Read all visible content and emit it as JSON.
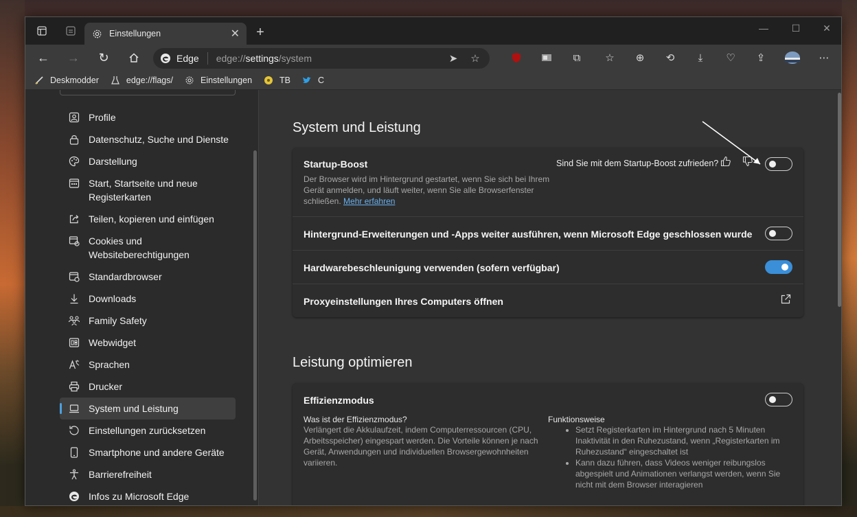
{
  "window": {
    "tab_title": "Einstellungen",
    "new_tab_symbol": "+",
    "close_tab_symbol": "✕"
  },
  "toolbar": {
    "brand": "Edge",
    "url_prefix": "edge://",
    "url_bold": "settings",
    "url_suffix": "/system"
  },
  "favorites": [
    {
      "label": "Deskmodder",
      "icon": "pen-icon"
    },
    {
      "label": "edge://flags/",
      "icon": "flask-icon"
    },
    {
      "label": "Einstellungen",
      "icon": "gear-icon"
    },
    {
      "label": "TB",
      "icon": "yellow-circle-icon"
    },
    {
      "label": "C",
      "icon": "twitter-bird-icon"
    }
  ],
  "sidebar": {
    "items": [
      {
        "label": "Profile",
        "icon": "profile-icon"
      },
      {
        "label": "Datenschutz, Suche und Dienste",
        "icon": "lock-icon"
      },
      {
        "label": "Darstellung",
        "icon": "palette-icon"
      },
      {
        "label": "Start, Startseite und neue Registerkarten",
        "icon": "start-page-icon"
      },
      {
        "label": "Teilen, kopieren und einfügen",
        "icon": "share-icon"
      },
      {
        "label": "Cookies und Websiteberechtigungen",
        "icon": "cookies-icon"
      },
      {
        "label": "Standardbrowser",
        "icon": "default-browser-icon"
      },
      {
        "label": "Downloads",
        "icon": "download-icon"
      },
      {
        "label": "Family Safety",
        "icon": "family-icon"
      },
      {
        "label": "Webwidget",
        "icon": "widget-icon"
      },
      {
        "label": "Sprachen",
        "icon": "language-icon"
      },
      {
        "label": "Drucker",
        "icon": "printer-icon"
      },
      {
        "label": "System und Leistung",
        "icon": "laptop-icon",
        "active": true
      },
      {
        "label": "Einstellungen zurücksetzen",
        "icon": "reset-icon"
      },
      {
        "label": "Smartphone und andere Geräte",
        "icon": "phone-icon"
      },
      {
        "label": "Barrierefreiheit",
        "icon": "accessibility-icon"
      },
      {
        "label": "Infos zu Microsoft Edge",
        "icon": "edge-logo-icon"
      }
    ]
  },
  "main": {
    "section1_title": "System und Leistung",
    "startup": {
      "title": "Startup-Boost",
      "desc": "Der Browser wird im Hintergrund gestartet, wenn Sie sich bei Ihrem Gerät anmelden, und läuft weiter, wenn Sie alle Browserfenster schließen.",
      "link": "Mehr erfahren",
      "feedback": "Sind Sie mit dem Startup-Boost zufrieden?",
      "enabled": false
    },
    "background_apps": {
      "title": "Hintergrund-Erweiterungen und -Apps weiter ausführen, wenn Microsoft Edge geschlossen wurde",
      "enabled": false
    },
    "hardware_accel": {
      "title": "Hardwarebeschleunigung verwenden (sofern verfügbar)",
      "enabled": true
    },
    "proxy": {
      "title": "Proxyeinstellungen Ihres Computers öffnen"
    },
    "section2_title": "Leistung optimieren",
    "efficiency": {
      "title": "Effizienzmodus",
      "enabled": false,
      "what_title": "Was ist der Effizienzmodus?",
      "what_text": "Verlängert die Akkulaufzeit, indem Computerressourcen (CPU, Arbeitsspeicher) eingespart werden. Die Vorteile können je nach Gerät, Anwendungen und individuellen Browsergewohnheiten variieren.",
      "how_title": "Funktionsweise",
      "how_items": [
        "Setzt Registerkarten im Hintergrund nach 5 Minuten Inaktivität in den Ruhezustand, wenn „Registerkarten im Ruhezustand“ eingeschaltet ist",
        "Kann dazu führen, dass Videos weniger reibungslos abgespielt und Animationen verlangst werden, wenn Sie nicht mit dem Browser interagieren"
      ]
    }
  },
  "colors": {
    "accent": "#3a8fd8",
    "link": "#68b1f0"
  }
}
